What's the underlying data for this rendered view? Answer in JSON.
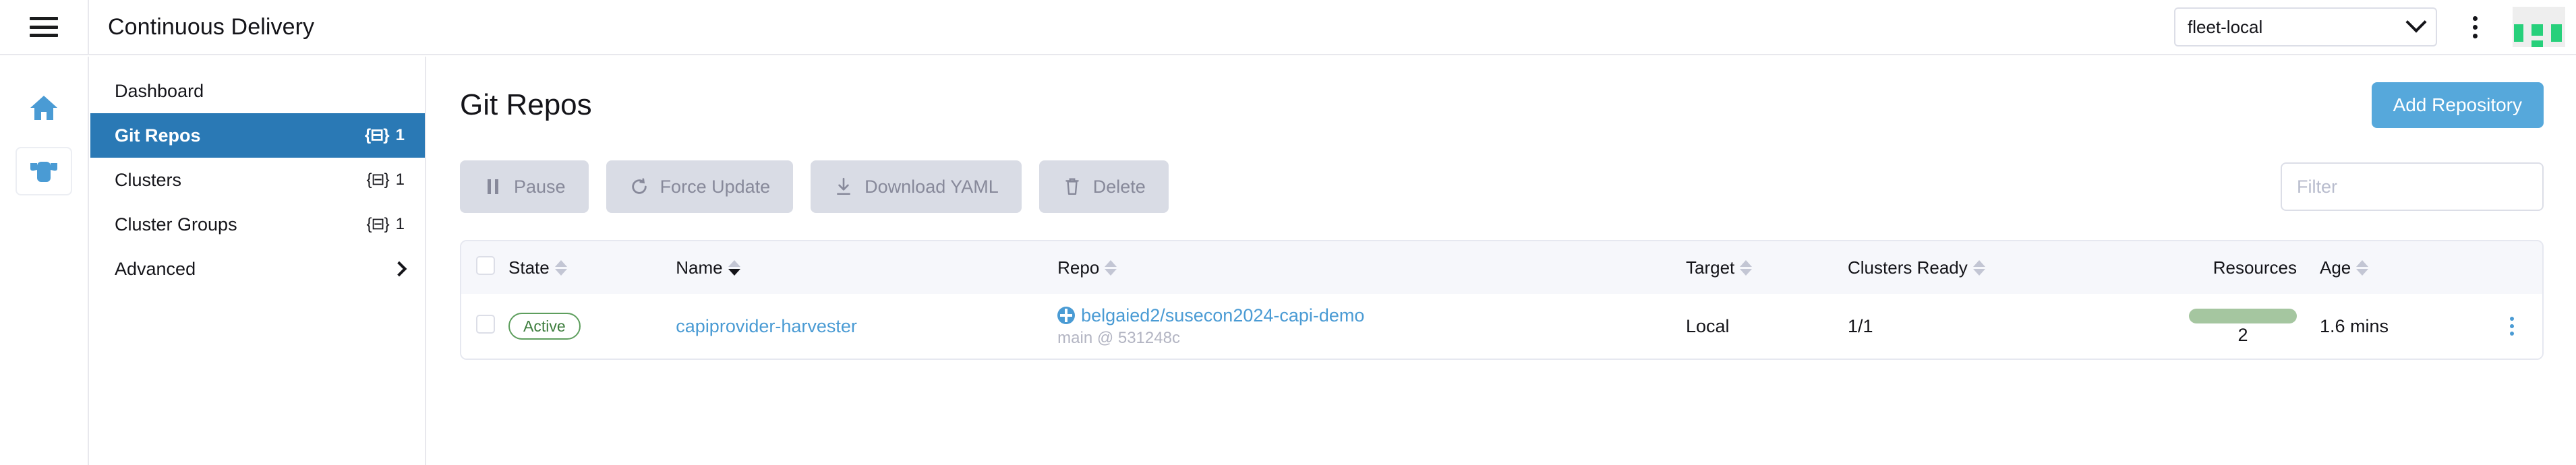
{
  "header": {
    "menu_icon": "hamburger-icon",
    "title": "Continuous Delivery",
    "cluster_selector": {
      "value": "fleet-local",
      "chevron_icon": "chevron-down-icon"
    },
    "kebab_icon": "kebab-menu-icon",
    "logo": "rancher-logo-icon"
  },
  "rail": {
    "items": [
      {
        "name": "home",
        "icon": "home-icon"
      },
      {
        "name": "fleet",
        "icon": "cow-icon"
      }
    ]
  },
  "sidebar": {
    "items": [
      {
        "label": "Dashboard",
        "badge": "",
        "badge_icon": "",
        "active": false,
        "chevron": false
      },
      {
        "label": "Git Repos",
        "badge": "1",
        "badge_icon": "yaml-icon",
        "active": true,
        "chevron": false
      },
      {
        "label": "Clusters",
        "badge": "1",
        "badge_icon": "yaml-icon",
        "active": false,
        "chevron": false
      },
      {
        "label": "Cluster Groups",
        "badge": "1",
        "badge_icon": "yaml-icon",
        "active": false,
        "chevron": false
      },
      {
        "label": "Advanced",
        "badge": "",
        "badge_icon": "",
        "active": false,
        "chevron": true
      }
    ],
    "badge_glyph": "{⊟}"
  },
  "main": {
    "page_title": "Git Repos",
    "add_button": "Add Repository",
    "toolbar": [
      {
        "label": "Pause",
        "icon": "pause-icon"
      },
      {
        "label": "Force Update",
        "icon": "refresh-icon"
      },
      {
        "label": "Download YAML",
        "icon": "download-icon"
      },
      {
        "label": "Delete",
        "icon": "trash-icon"
      }
    ],
    "filter": {
      "placeholder": "Filter",
      "value": ""
    },
    "table": {
      "columns": [
        {
          "label": "State",
          "sortable": true,
          "sorted": false
        },
        {
          "label": "Name",
          "sortable": true,
          "sorted": true
        },
        {
          "label": "Repo",
          "sortable": true,
          "sorted": false
        },
        {
          "label": "Target",
          "sortable": true,
          "sorted": false
        },
        {
          "label": "Clusters Ready",
          "sortable": true,
          "sorted": false
        },
        {
          "label": "Resources",
          "sortable": false,
          "sorted": false
        },
        {
          "label": "Age",
          "sortable": true,
          "sorted": false
        }
      ],
      "rows": [
        {
          "state": "Active",
          "name": "capiprovider-harvester",
          "repo_url": "belgaied2/susecon2024-capi-demo",
          "repo_branch": "main @ 531248c",
          "repo_icon": "globe-icon",
          "target": "Local",
          "clusters_ready": "1/1",
          "resources_count": "2",
          "age": "1.6 mins",
          "actions_icon": "row-kebab-icon"
        }
      ]
    }
  },
  "colors": {
    "accent_blue": "#2a79b5",
    "link_blue": "#4a9bd4",
    "button_blue": "#56a8db",
    "active_green": "#5d9e5d",
    "resource_bar_green": "#a5c6a0",
    "logo_green": "#27d07b",
    "disabled_grey": "#d9dce5"
  }
}
